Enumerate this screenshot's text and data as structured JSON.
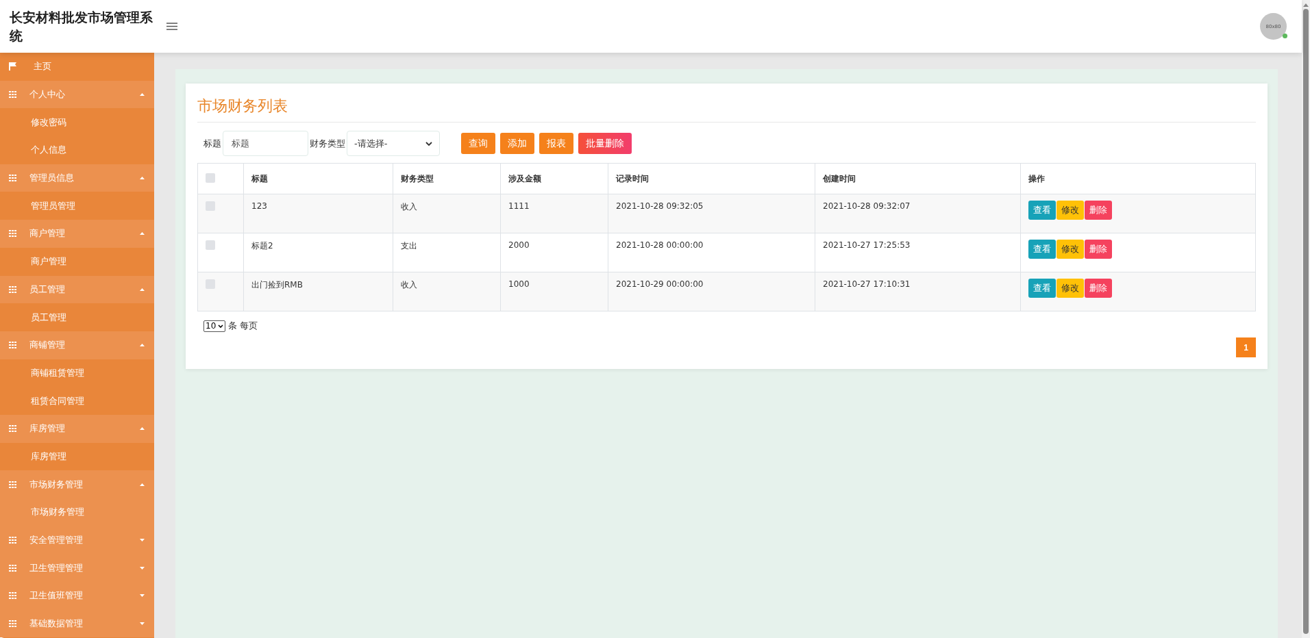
{
  "header": {
    "title": "长安材料批发市场管理系统",
    "avatar": {
      "text": "80x80",
      "online": true
    }
  },
  "menu": [
    {
      "kind": "home",
      "label": "主页"
    },
    {
      "kind": "group",
      "label": "个人中心",
      "expanded": true,
      "children": [
        {
          "label": "修改密码",
          "selected": false
        },
        {
          "label": "个人信息",
          "selected": false
        }
      ]
    },
    {
      "kind": "group",
      "label": "管理员信息",
      "expanded": true,
      "children": [
        {
          "label": "管理员管理",
          "selected": false
        }
      ]
    },
    {
      "kind": "group",
      "label": "商户管理",
      "expanded": true,
      "children": [
        {
          "label": "商户管理",
          "selected": false
        }
      ]
    },
    {
      "kind": "group",
      "label": "员工管理",
      "expanded": true,
      "children": [
        {
          "label": "员工管理",
          "selected": false
        }
      ]
    },
    {
      "kind": "group",
      "label": "商铺管理",
      "expanded": true,
      "children": [
        {
          "label": "商铺租赁管理",
          "selected": false
        },
        {
          "label": "租赁合同管理",
          "selected": false
        }
      ]
    },
    {
      "kind": "group",
      "label": "库房管理",
      "expanded": true,
      "children": [
        {
          "label": "库房管理",
          "selected": false
        }
      ]
    },
    {
      "kind": "group",
      "label": "市场财务管理",
      "expanded": true,
      "children": [
        {
          "label": "市场财务管理",
          "selected": true
        }
      ]
    },
    {
      "kind": "group",
      "label": "安全管理管理",
      "expanded": false
    },
    {
      "kind": "group",
      "label": "卫生管理管理",
      "expanded": false
    },
    {
      "kind": "group",
      "label": "卫生值班管理",
      "expanded": false
    },
    {
      "kind": "group",
      "label": "基础数据管理",
      "expanded": false
    }
  ],
  "card": {
    "title": "市场财务列表",
    "filters": [
      {
        "kind": "input",
        "label": "标题",
        "placeholder": "标题"
      },
      {
        "kind": "select",
        "label": "财务类型",
        "value": "-请选择-"
      }
    ],
    "buttons": [
      {
        "kind": "primary",
        "label": "查询"
      },
      {
        "kind": "primary",
        "label": "添加"
      },
      {
        "kind": "primary",
        "label": "报表"
      },
      {
        "kind": "danger",
        "label": "批量删除"
      }
    ],
    "table": {
      "select_all_checked": false,
      "columns": [
        "标题",
        "财务类型",
        "涉及金额",
        "记录时间",
        "创建时间",
        "操作"
      ],
      "rows": [
        {
          "checked": false,
          "cells": [
            "123",
            "收入",
            "1111",
            "2021-10-28 09:32:05",
            "2021-10-28 09:32:07"
          ],
          "actions": [
            {
              "kind": "view",
              "label": "查看"
            },
            {
              "kind": "edit",
              "label": "修改"
            },
            {
              "kind": "delete",
              "label": "删除"
            }
          ]
        },
        {
          "checked": false,
          "cells": [
            "标题2",
            "支出",
            "2000",
            "2021-10-28 00:00:00",
            "2021-10-27 17:25:53"
          ],
          "actions": [
            {
              "kind": "view",
              "label": "查看"
            },
            {
              "kind": "edit",
              "label": "修改"
            },
            {
              "kind": "delete",
              "label": "删除"
            }
          ]
        },
        {
          "checked": false,
          "cells": [
            "出门捡到RMB",
            "收入",
            "1000",
            "2021-10-29 00:00:00",
            "2021-10-27 17:10:31"
          ],
          "actions": [
            {
              "kind": "view",
              "label": "查看"
            },
            {
              "kind": "edit",
              "label": "修改"
            },
            {
              "kind": "delete",
              "label": "删除"
            }
          ]
        }
      ]
    },
    "pagination": {
      "page_size": "10",
      "page_size_label": "条 每页",
      "pages": [
        {
          "label": "1",
          "selected": true
        }
      ]
    }
  }
}
